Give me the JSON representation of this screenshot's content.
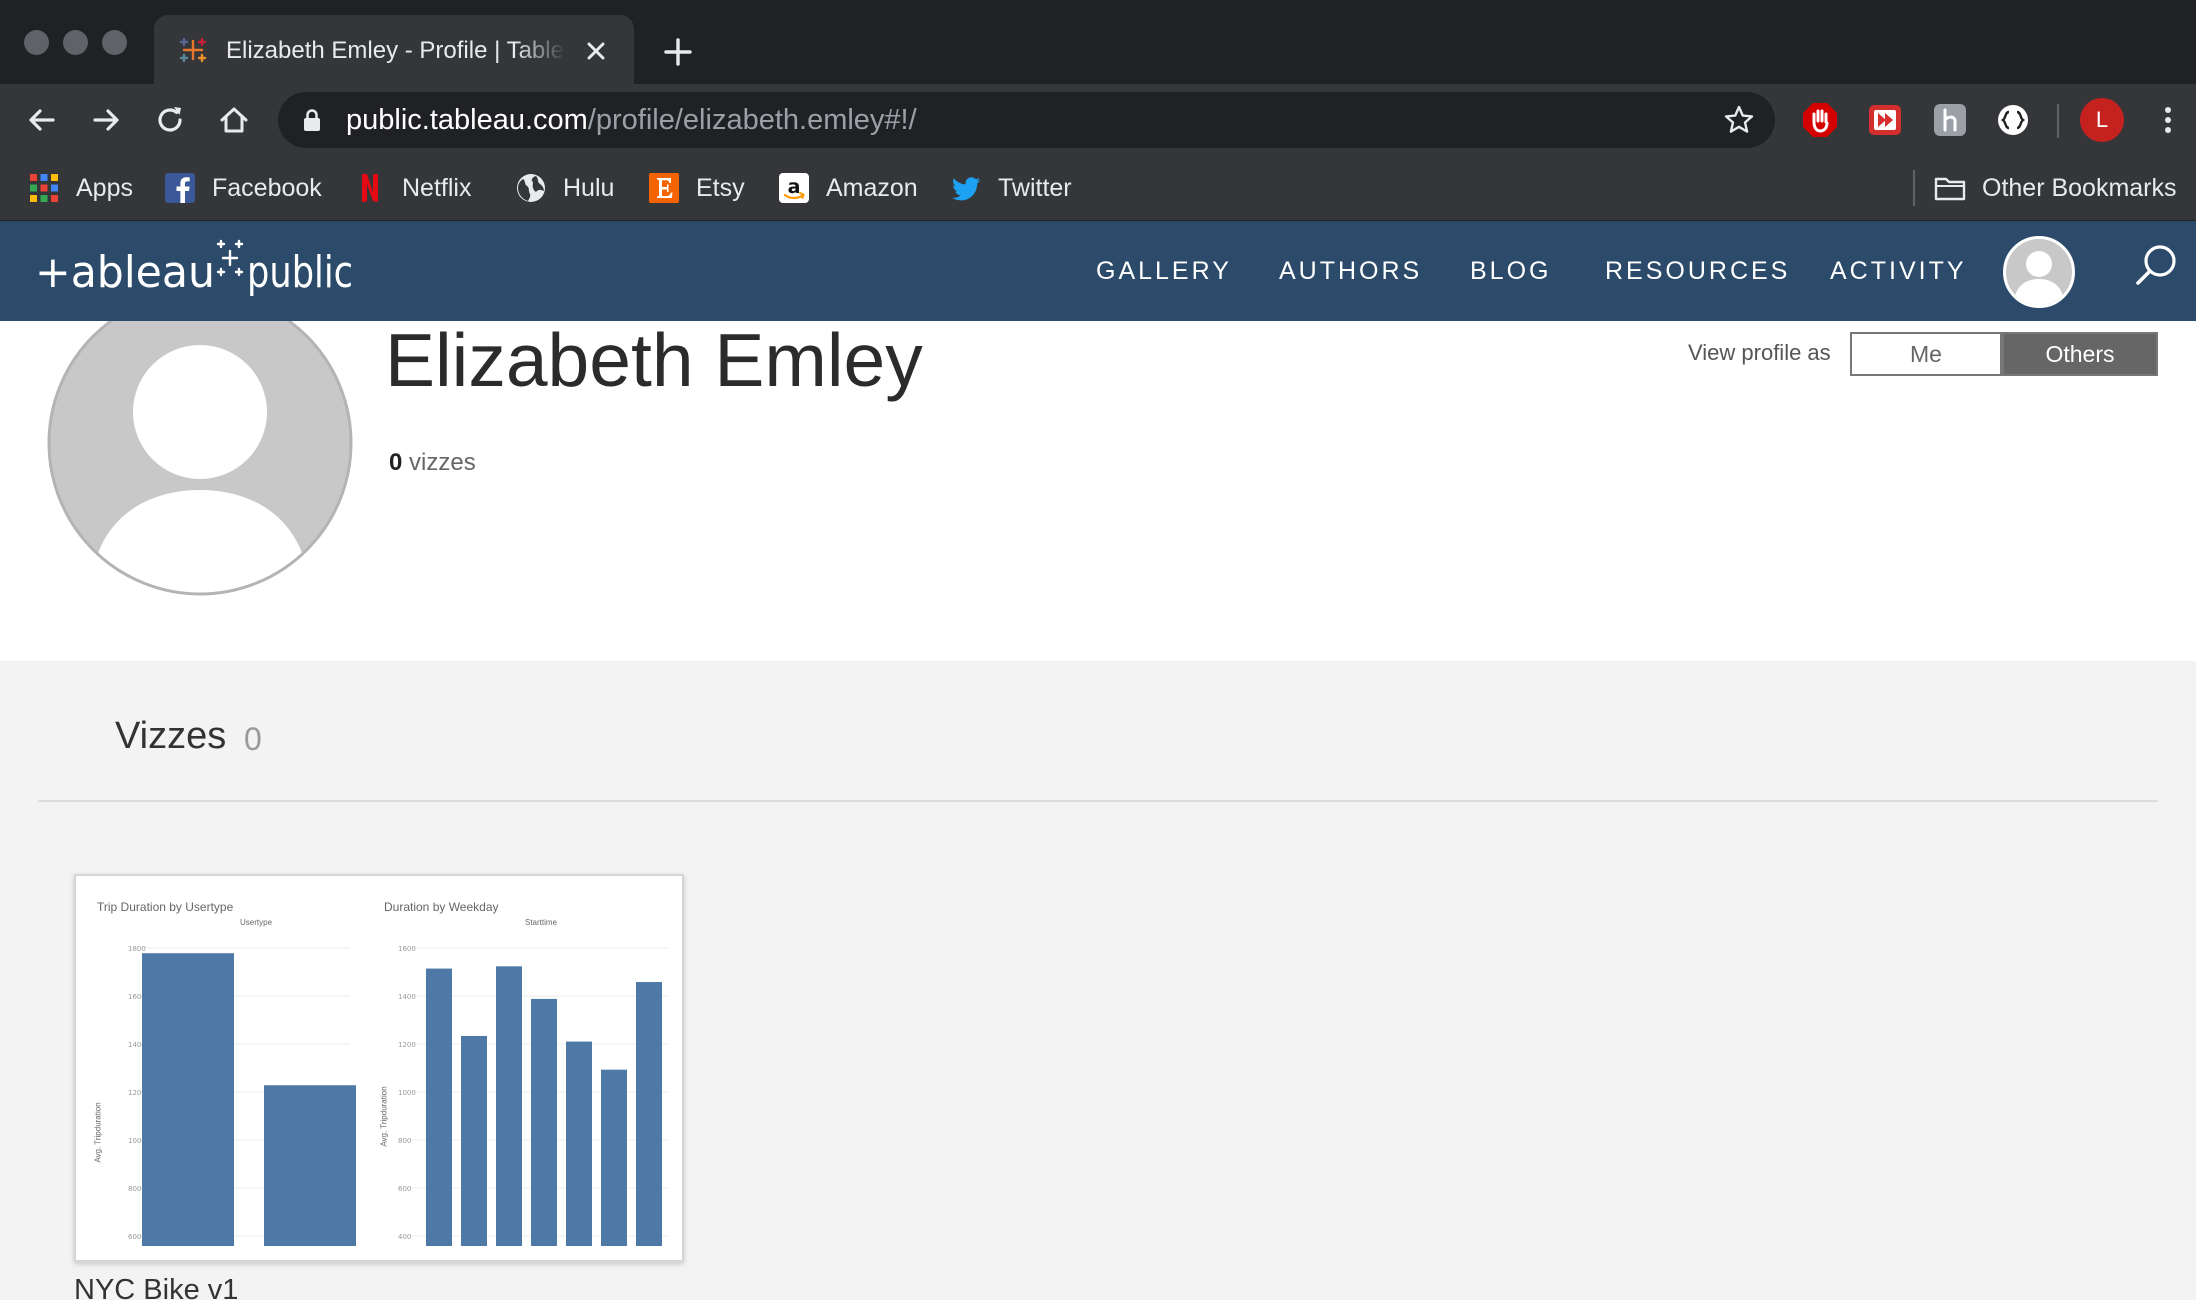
{
  "browser": {
    "tab_title": "Elizabeth Emley - Profile | Tableau Public",
    "url_host": "public.tableau.com",
    "url_path": "/profile/elizabeth.emley#!/",
    "profile_initial": "L",
    "bookmarks": [
      "Apps",
      "Facebook",
      "Netflix",
      "Hulu",
      "Etsy",
      "Amazon",
      "Twitter"
    ],
    "other_bookmarks": "Other Bookmarks"
  },
  "site": {
    "nav": [
      "GALLERY",
      "AUTHORS",
      "BLOG",
      "RESOURCES",
      "ACTIVITY"
    ]
  },
  "profile": {
    "name": "Elizabeth Emley",
    "viz_count": "0",
    "viz_count_label": "vizzes",
    "view_as_label": "View profile as",
    "view_as_options": [
      "Me",
      "Others"
    ],
    "view_as_selected": "Others"
  },
  "vizzes": {
    "title": "Vizzes",
    "count": "0",
    "items": [
      {
        "title": "NYC Bike v1",
        "thumbnail": {
          "left_title": "Trip Duration by Usertype",
          "left_header": "Usertype",
          "left_axis_label": "Avg. Tripduration",
          "left_ticks": [
            "1800",
            "1600",
            "1400",
            "1200",
            "1000",
            "800",
            "600"
          ],
          "right_title": "Duration by Weekday",
          "right_header": "Starttime",
          "right_axis_label": "Avg. Tripduration",
          "right_ticks": [
            "1600",
            "1400",
            "1200",
            "1000",
            "800",
            "600",
            "400"
          ]
        },
        "chart_data": [
          {
            "type": "bar",
            "title": "Trip Duration by Usertype",
            "ylabel": "Avg. Tripduration",
            "ylim": [
              500,
              1850
            ],
            "values": [
              1775,
              1200
            ]
          },
          {
            "type": "bar",
            "title": "Duration by Weekday",
            "ylabel": "Avg. Tripduration",
            "ylim": [
              300,
              1680
            ],
            "values": [
              1535,
              1235,
              1545,
              1400,
              1210,
              1085,
              1475
            ]
          }
        ]
      }
    ]
  },
  "colors": {
    "header_bg": "#2c4b6a",
    "bar": "#4e79a7",
    "seg_active": "#666666"
  }
}
